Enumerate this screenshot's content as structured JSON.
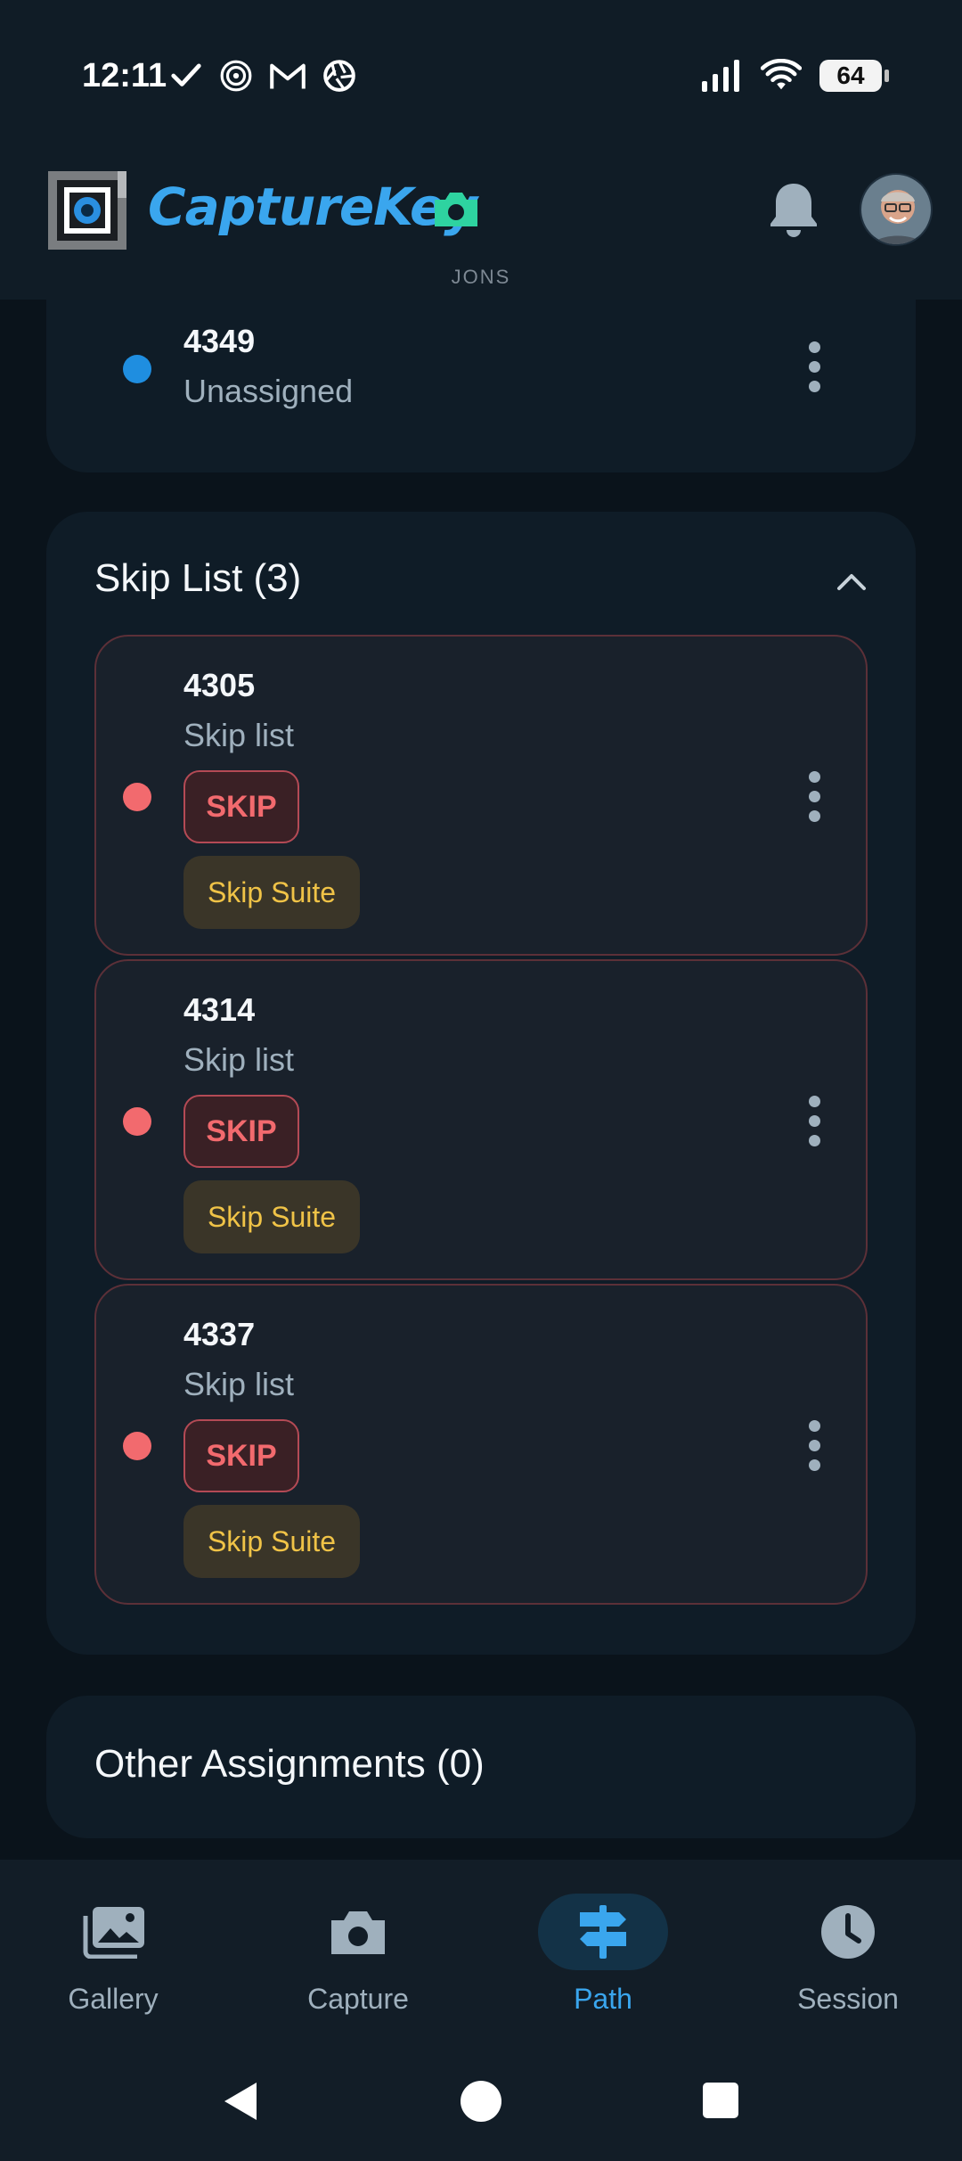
{
  "status_bar": {
    "time": "12:11",
    "battery": "64",
    "icons_left": [
      "check-icon",
      "spiral-icon",
      "gmail-icon",
      "aperture-icon"
    ],
    "icons_right": [
      "signal-icon",
      "wifi-icon",
      "battery-icon"
    ]
  },
  "header": {
    "brand": "CaptureKey",
    "subtitle": "JONS",
    "brand_color": "#3aa6ee",
    "camera_color": "#2ed3a0"
  },
  "unassigned_row": {
    "id": "4349",
    "status": "Unassigned",
    "dot_color": "#1f8ee0"
  },
  "skip_list": {
    "title": "Skip List (3)",
    "items": [
      {
        "id": "4305",
        "status": "Skip list",
        "skip_label": "SKIP",
        "suite_label": "Skip Suite"
      },
      {
        "id": "4314",
        "status": "Skip list",
        "skip_label": "SKIP",
        "suite_label": "Skip Suite"
      },
      {
        "id": "4337",
        "status": "Skip list",
        "skip_label": "SKIP",
        "suite_label": "Skip Suite"
      }
    ],
    "dot_color": "#f26a6e"
  },
  "other_assignments": {
    "title": "Other Assignments (0)"
  },
  "bottom_nav": {
    "items": [
      {
        "label": "Gallery",
        "icon": "gallery-icon",
        "active": false
      },
      {
        "label": "Capture",
        "icon": "camera-icon",
        "active": false
      },
      {
        "label": "Path",
        "icon": "signpost-icon",
        "active": true
      },
      {
        "label": "Session",
        "icon": "clock-icon",
        "active": false
      }
    ],
    "active_color": "#3aa6ee"
  }
}
